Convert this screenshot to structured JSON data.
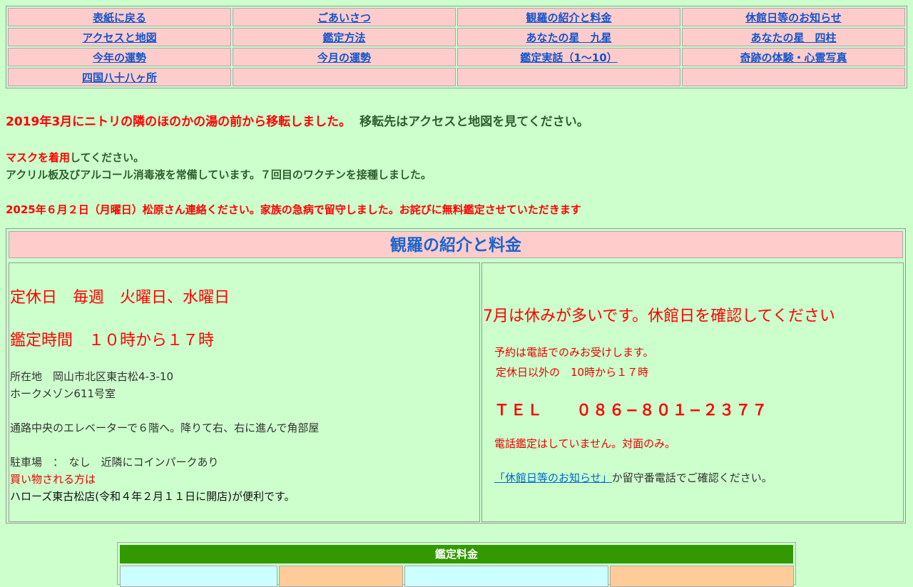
{
  "nav": [
    [
      "表紙に戻る",
      "ごあいさつ",
      "観羅の紹介と料金",
      "休館日等のお知らせ"
    ],
    [
      "アクセスと地図",
      "鑑定方法",
      "あなたの星　九星",
      "あなたの星　四柱"
    ],
    [
      "今年の運勢",
      "今月の運勢",
      "鑑定実話（1〜10）",
      "奇跡の体験・心霊写真"
    ],
    [
      "四国八十八ヶ所",
      "",
      "",
      ""
    ]
  ],
  "notices": {
    "move_red": "2019年3月にニトリの隣のほのかの湯の前から移転しました。",
    "move_rest": "移転先はアクセスと地図を見てください。",
    "mask_red": "マスクを着用",
    "mask_rest": "してください。",
    "acrylic": "アクリル板及びアルコール消毒液を常備しています。７回目のワクチンを接種しました。",
    "urgent": "2025年６月２日（月曜日）松原さん連絡ください。家族の急病で留守しました。お詫びに無料鑑定させていただきます"
  },
  "section": {
    "title": "観羅の紹介と料金",
    "left": {
      "closed_days": "定休日　毎週　火曜日、水曜日",
      "hours": "鑑定時間　１０時から１７時",
      "address1": "所在地　岡山市北区東古松4-3-10",
      "address2": "ホークメゾン611号室",
      "directions": "通路中央のエレベーターで６階へ。降りて右、右に進んで角部屋",
      "parking": "駐車場　：　なし　近隣にコインパークあり",
      "shopping_red": "買い物される方は",
      "shopping": "ハローズ東古松店(令和４年２月１１日に開店)が便利です。"
    },
    "right": {
      "july": "7月は休みが多いです。休館日を確認してください",
      "reserve1": "予約は電話でのみお受けします。",
      "reserve2": "定休日以外の　10時から１７時",
      "tel": "ＴＥＬ　　０８６−８０１−２３７７",
      "no_phone": "電話鑑定はしていません。対面のみ。",
      "link": "「休館日等のお知らせ」",
      "link_rest": "か留守番電話でご確認ください。"
    }
  },
  "fee": {
    "title": "鑑定料金"
  },
  "colors": {
    "background": "#ccffcc",
    "nav_cell": "#ffcccc",
    "accent_red": "#ff0000",
    "link_blue": "#1155cc",
    "fee_header": "#339900"
  }
}
